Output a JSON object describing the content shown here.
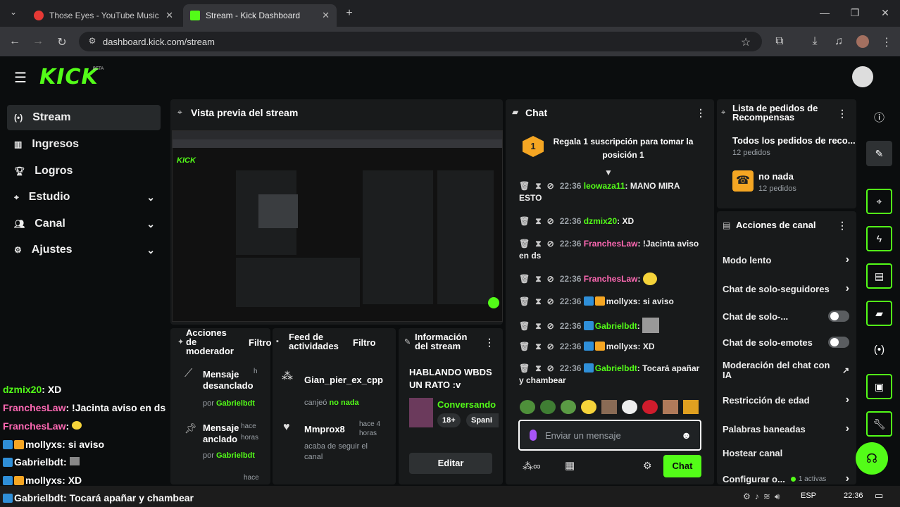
{
  "browser": {
    "tabs": [
      {
        "title": "Those Eyes - YouTube Music",
        "active": false
      },
      {
        "title": "Stream - Kick Dashboard",
        "active": true
      }
    ],
    "url": "dashboard.kick.com/stream"
  },
  "header": {
    "logo": "KICK",
    "beta": "BETA"
  },
  "sidebar": {
    "items": [
      {
        "label": "Stream",
        "icon": "broadcast-icon",
        "active": true
      },
      {
        "label": "Ingresos",
        "icon": "chart-icon"
      },
      {
        "label": "Logros",
        "icon": "trophy-icon"
      },
      {
        "label": "Estudio",
        "icon": "studio-icon",
        "expandable": true
      },
      {
        "label": "Canal",
        "icon": "users-icon",
        "expandable": true
      },
      {
        "label": "Ajustes",
        "icon": "gear-icon",
        "expandable": true
      }
    ]
  },
  "overlay_chat": [
    {
      "user": "dzmix20",
      "sep": ":",
      "text": "XD",
      "color": "#53fc18"
    },
    {
      "user": "FranchesLaw",
      "sep": ":",
      "text": "!Jacinta aviso en ds",
      "color": "#ff69b4"
    },
    {
      "user": "FranchesLaw",
      "sep": ":",
      "text": "",
      "color": "#ff69b4",
      "emote": true
    },
    {
      "user": "mollyxs",
      "sep": ":",
      "text": "si aviso",
      "color": "#fff"
    },
    {
      "user": "Gabrielbdt",
      "sep": ":",
      "text": "",
      "color": "#fff",
      "emote": true
    },
    {
      "user": "mollyxs",
      "sep": ":",
      "text": "XD",
      "color": "#fff"
    },
    {
      "user": "Gabrielbdt",
      "sep": ":",
      "text": "Tocará apañar y chambear",
      "color": "#fff"
    }
  ],
  "preview": {
    "title": "Vista previa del stream"
  },
  "mod_actions": {
    "title": "Acciones de moderador",
    "filter": "Filtro",
    "items": [
      {
        "title": "Mensaje desanclado",
        "by": "por",
        "user": "Gabrielbdt",
        "time": "h"
      },
      {
        "title": "Mensaje anclado",
        "by": "por",
        "user": "Gabrielbdt",
        "time": "hace horas"
      }
    ],
    "more_time": "hace"
  },
  "activity": {
    "title": "Feed de actividades",
    "filter": "Filtro",
    "items": [
      {
        "user": "Gian_pier_ex_cpp",
        "action": "canjeó",
        "reward": "no nada"
      },
      {
        "user": "Mmprox8",
        "time": "hace 4 horas",
        "action": "acaba de seguir el canal"
      }
    ]
  },
  "stream_info": {
    "title": "Información del stream",
    "stream_title": "HABLANDO WBDS UN RATO :v",
    "category": "Conversando",
    "tags": [
      "18+",
      "Spani"
    ],
    "edit": "Editar"
  },
  "chat": {
    "title": "Chat",
    "pinned": "Regala 1 suscripción para tomar la posición 1",
    "pinned_rank": "1",
    "messages": [
      {
        "time": "22:36",
        "user": "leowaza11",
        "color": "#53fc18",
        "text": "MANO MIRA ESTO"
      },
      {
        "time": "22:36",
        "user": "dzmix20",
        "color": "#53fc18",
        "text": "XD"
      },
      {
        "time": "22:36",
        "user": "FranchesLaw",
        "color": "#ff69b4",
        "text": "!Jacinta aviso en ds"
      },
      {
        "time": "22:36",
        "user": "FranchesLaw",
        "color": "#ff69b4",
        "text": ""
      },
      {
        "time": "22:36",
        "user": "mollyxs",
        "color": "#ffffff",
        "text": "si aviso"
      },
      {
        "time": "22:36",
        "user": "Gabrielbdt",
        "color": "#53fc18",
        "text": ""
      },
      {
        "time": "22:36",
        "user": "mollyxs",
        "color": "#ffffff",
        "text": "XD"
      },
      {
        "time": "22:36",
        "user": "Gabrielbdt",
        "color": "#53fc18",
        "text": "Tocará apañar y chambear"
      }
    ],
    "input_placeholder": "Enviar un mensaje",
    "send": "Chat"
  },
  "rewards": {
    "title": "Lista de pedidos de Recompensas",
    "all": "Todos los pedidos de reco...",
    "all_count": "12 pedidos",
    "item": "no nada",
    "item_count": "12 pedidos"
  },
  "channel_actions": {
    "title": "Acciones de canal",
    "rows": [
      {
        "label": "Modo lento",
        "kind": "chevron"
      },
      {
        "label": "Chat de solo-seguidores",
        "kind": "chevron"
      },
      {
        "label": "Chat de solo-...",
        "kind": "toggle"
      },
      {
        "label": "Chat de solo-emotes",
        "kind": "toggle"
      },
      {
        "label": "Moderación del chat con IA",
        "kind": "external"
      },
      {
        "label": "Restricción de edad",
        "kind": "chevron"
      },
      {
        "label": "Palabras baneadas",
        "kind": "chevron"
      },
      {
        "label": "Hostear canal",
        "kind": "none"
      },
      {
        "label": "Configurar o...",
        "kind": "chevron",
        "status": "1 activas"
      }
    ]
  },
  "taskbar": {
    "lang": "ESP",
    "time": "22:36"
  },
  "colors": {
    "accent": "#53fc18",
    "panel": "#181a1b",
    "bg": "#0b0d0e"
  }
}
